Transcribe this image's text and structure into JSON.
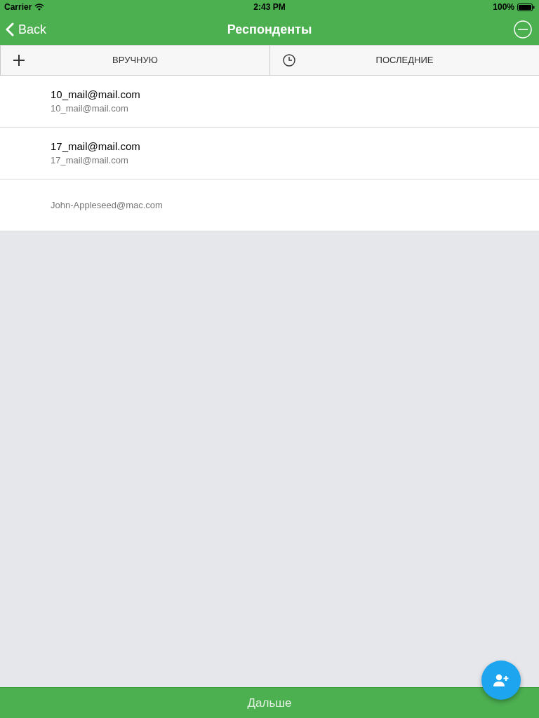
{
  "status_bar": {
    "carrier": "Carrier",
    "time": "2:43 PM",
    "battery": "100%"
  },
  "nav_bar": {
    "back": "Back",
    "title": "Респонденты"
  },
  "segments": [
    {
      "kind": "plus",
      "label": "ВРУЧНУЮ"
    },
    {
      "kind": "clock",
      "label": "ПОСЛЕДНИЕ"
    }
  ],
  "respondents": [
    {
      "title": "10_mail@mail.com",
      "subtitle": "10_mail@mail.com"
    },
    {
      "title": "17_mail@mail.com",
      "subtitle": "17_mail@mail.com"
    },
    {
      "subtitle": "John-Appleseed@mac.com"
    }
  ],
  "bottom_bar": {
    "label": "Дальше"
  }
}
